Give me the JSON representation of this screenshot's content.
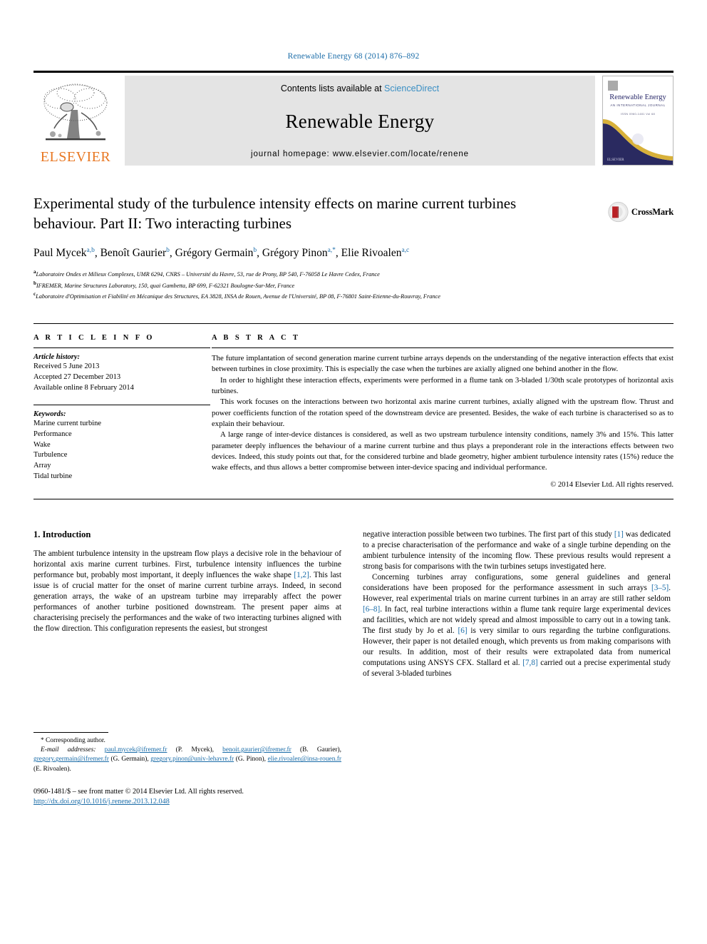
{
  "running_head": "Renewable Energy 68 (2014) 876–892",
  "masthead": {
    "publisher_name": "ELSEVIER",
    "contents_prefix": "Contents lists available at ",
    "sciencedirect": "ScienceDirect",
    "journal_title": "Renewable Energy",
    "homepage": "journal homepage: www.elsevier.com/locate/renene",
    "cover": {
      "title": "Renewable Energy",
      "subtitle": "AN INTERNATIONAL JOURNAL",
      "subtitle2": "ISSN 0960-1481 Vol 68",
      "publisher": "ELSEVIER"
    }
  },
  "article": {
    "title": "Experimental study of the turbulence intensity effects on marine current turbines behaviour. Part II: Two interacting turbines",
    "crossmark_label": "CrossMark",
    "authors": [
      {
        "name": "Paul Mycek",
        "sup": "a,b",
        "sep": ", "
      },
      {
        "name": "Benoît Gaurier",
        "sup": "b",
        "sep": ", "
      },
      {
        "name": "Grégory Germain",
        "sup": "b",
        "sep": ", "
      },
      {
        "name": "Grégory Pinon",
        "sup": "a,*",
        "sep": ", "
      },
      {
        "name": "Elie Rivoalen",
        "sup": "a,c",
        "sep": ""
      }
    ],
    "affiliations": [
      {
        "sup": "a",
        "text": "Laboratoire Ondes et Milieux Complexes, UMR 6294, CNRS – Université du Havre, 53, rue de Prony, BP 540, F-76058 Le Havre Cedex, France"
      },
      {
        "sup": "b",
        "text": "IFREMER, Marine Structures Laboratory, 150, quai Gambetta, BP 699, F-62321 Boulogne-Sur-Mer, France"
      },
      {
        "sup": "c",
        "text": "Laboratoire d'Optimisation et Fiabilité en Mécanique des Structures, EA 3828, INSA de Rouen, Avenue de l'Université, BP 08, F-76801 Saint-Etienne-du-Rouvray, France"
      }
    ]
  },
  "article_info": {
    "heading": "A R T I C L E   I N F O",
    "history_label": "Article history:",
    "history": [
      "Received 5 June 2013",
      "Accepted 27 December 2013",
      "Available online 8 February 2014"
    ],
    "keywords_label": "Keywords:",
    "keywords": [
      "Marine current turbine",
      "Performance",
      "Wake",
      "Turbulence",
      "Array",
      "Tidal turbine"
    ]
  },
  "abstract": {
    "heading": "A B S T R A C T",
    "paragraphs": [
      "The future implantation of second generation marine current turbine arrays depends on the understanding of the negative interaction effects that exist between turbines in close proximity. This is especially the case when the turbines are axially aligned one behind another in the flow.",
      "In order to highlight these interaction effects, experiments were performed in a flume tank on 3-bladed 1/30th scale prototypes of horizontal axis turbines.",
      "This work focuses on the interactions between two horizontal axis marine current turbines, axially aligned with the upstream flow. Thrust and power coefficients function of the rotation speed of the downstream device are presented. Besides, the wake of each turbine is characterised so as to explain their behaviour.",
      "A large range of inter-device distances is considered, as well as two upstream turbulence intensity conditions, namely 3% and 15%. This latter parameter deeply influences the behaviour of a marine current turbine and thus plays a preponderant role in the interactions effects between two devices. Indeed, this study points out that, for the considered turbine and blade geometry, higher ambient turbulence intensity rates (15%) reduce the wake effects, and thus allows a better compromise between inter-device spacing and individual performance."
    ],
    "copyright": "© 2014 Elsevier Ltd. All rights reserved."
  },
  "body": {
    "section_heading": "1. Introduction",
    "left_column": {
      "paragraph_1_a": "The ambient turbulence intensity in the upstream flow plays a decisive role in the behaviour of horizontal axis marine current turbines. First, turbulence intensity influences the turbine performance but, probably most important, it deeply influences the wake shape ",
      "ref_1_2": "[1,2]",
      "paragraph_1_b": ". This last issue is of crucial matter for the onset of marine current turbine arrays. Indeed, in second generation arrays, the wake of an upstream turbine may irreparably affect the power performances of another turbine positioned downstream. The present paper aims at characterising precisely the performances and the wake of two interacting turbines aligned with the flow direction. This configuration represents the easiest, but strongest"
    },
    "right_column": {
      "p1_a": "negative interaction possible between two turbines. The first part of this study ",
      "p1_ref": "[1]",
      "p1_b": " was dedicated to a precise characterisation of the performance and wake of a single turbine depending on the ambient turbulence intensity of the incoming flow. These previous results would represent a strong basis for comparisons with the twin turbines setups investigated here.",
      "p2_a": "Concerning turbines array configurations, some general guidelines and general considerations have been proposed for the performance assessment in such arrays ",
      "p2_ref1": "[3–5]",
      "p2_b": ". However, real experimental trials on marine current turbines in an array are still rather seldom ",
      "p2_ref2": "[6–8]",
      "p2_c": ". In fact, real turbine interactions within a flume tank require large experimental devices and facilities, which are not widely spread and almost impossible to carry out in a towing tank. The first study by Jo et al. ",
      "p2_ref3": "[6]",
      "p2_d": " is very similar to ours regarding the turbine configurations. However, their paper is not detailed enough, which prevents us from making comparisons with our results. In addition, most of their results were extrapolated data from numerical computations using ANSYS CFX. Stallard et al. ",
      "p2_ref4": "[7,8]",
      "p2_e": " carried out a precise experimental study of several 3-bladed turbines"
    }
  },
  "footnote": {
    "corresponding": "* Corresponding author.",
    "email_label": "E-mail addresses:",
    "emails": [
      {
        "address": "paul.mycek@ifremer.fr",
        "owner": " (P. Mycek), "
      },
      {
        "address": "benoit.gaurier@ifremer.fr",
        "owner": " (B. Gaurier), "
      },
      {
        "address": "gregory.germain@ifremer.fr",
        "owner": " (G. Germain), "
      },
      {
        "address": "gregory.pinon@univ-lehavre.fr",
        "owner": " (G. Pinon), "
      },
      {
        "address": "elie.rivoalen@insa-rouen.fr",
        "owner": " (E. Rivoalen)."
      }
    ],
    "issn_line": "0960-1481/$ – see front matter © 2014 Elsevier Ltd. All rights reserved.",
    "doi": "http://dx.doi.org/10.1016/j.renene.2013.12.048"
  },
  "colors": {
    "link": "#1a6ca8",
    "sciencedirect": "#3a8fc4",
    "elsevier_orange": "#E87722",
    "band_gray": "#e4e4e4",
    "cover_navy": "#2a2a6a",
    "crossmark_red": "#b92025"
  }
}
